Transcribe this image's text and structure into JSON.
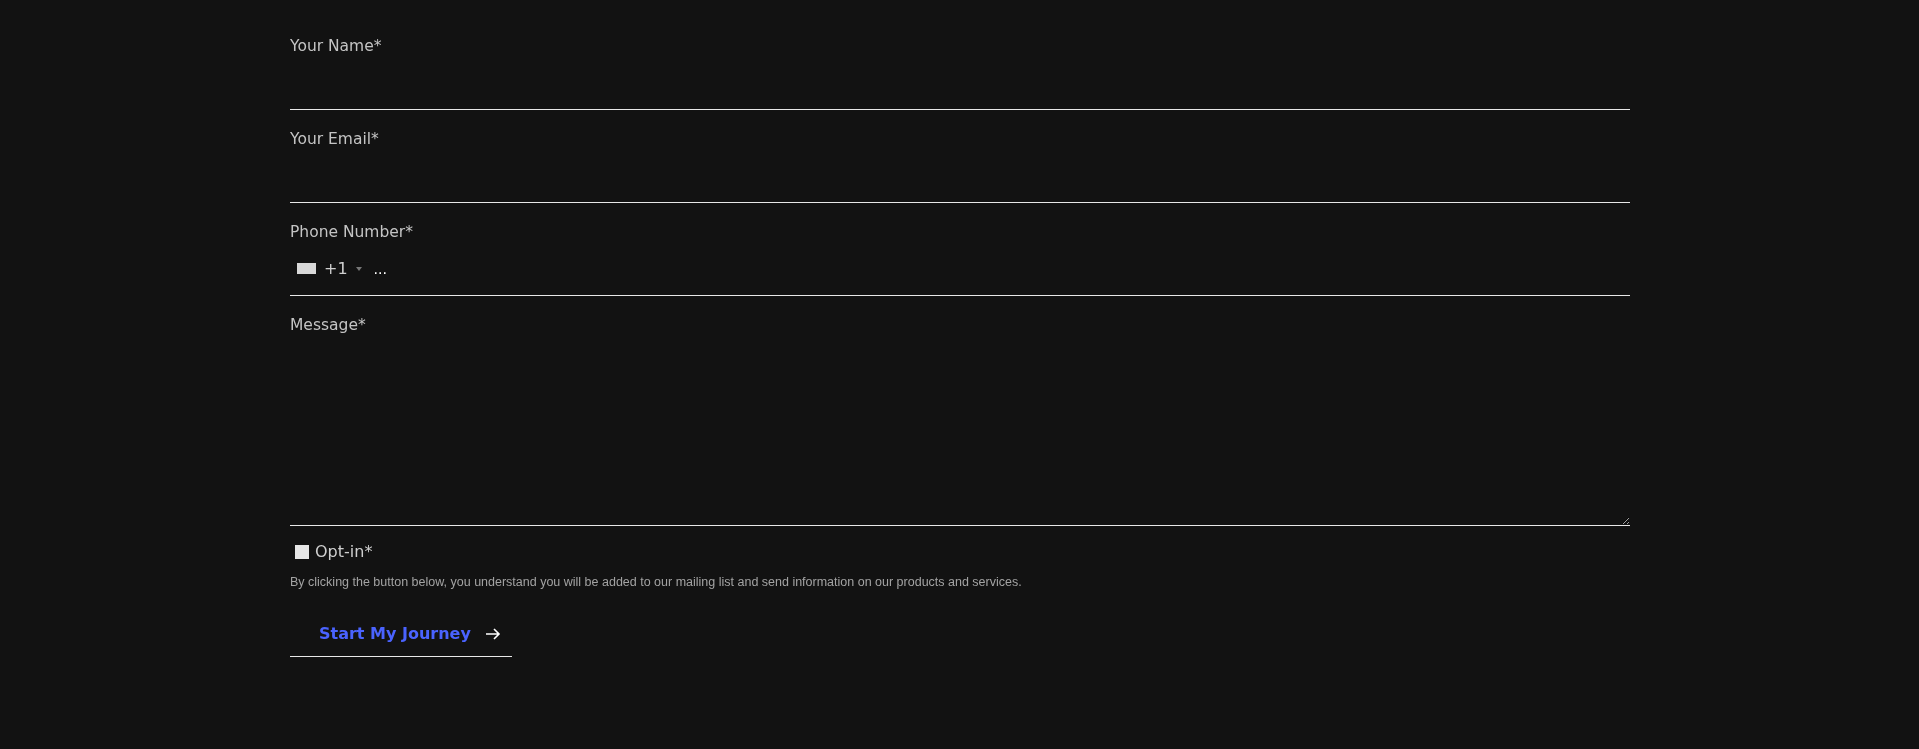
{
  "fields": [
    {
      "kind": "text",
      "label": "Your Name*"
    },
    {
      "kind": "text",
      "label": "Your Email*"
    },
    {
      "kind": "phone",
      "label": "Phone Number*",
      "dial_code": "+1",
      "value": "..."
    },
    {
      "kind": "textarea",
      "label": "Message*"
    }
  ],
  "opt_in": {
    "label": "Opt-in*",
    "checked": false
  },
  "notice": "By clicking the button below, you understand you will be added to our mailing list and send information on our products and services.",
  "submit": {
    "label": "Start My Journey"
  }
}
